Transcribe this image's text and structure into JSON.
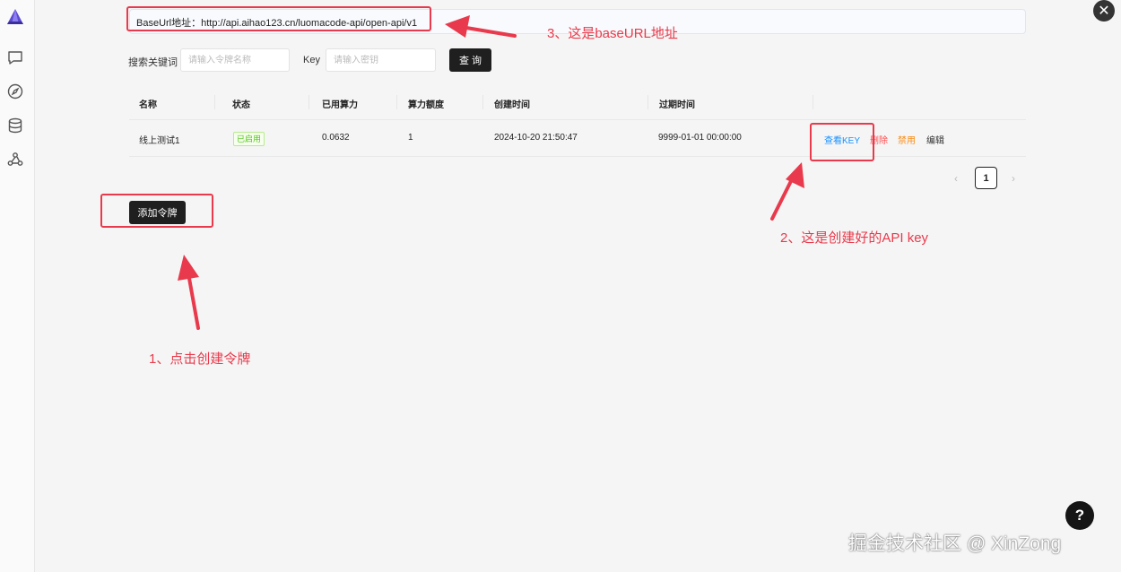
{
  "sidebar": {
    "icons": [
      "app-logo-icon",
      "chat-icon",
      "compass-icon",
      "database-icon",
      "webhook-icon"
    ]
  },
  "baseurl": {
    "text": "BaseUrl地址：http://api.aihao123.cn/luomacode-api/open-api/v1"
  },
  "search": {
    "keyword_label": "搜索关键词",
    "keyword_placeholder": "请输入令牌名称",
    "key_label": "Key",
    "key_placeholder": "请输入密钥",
    "query_button": "查 询"
  },
  "table": {
    "columns": [
      "名称",
      "状态",
      "已用算力",
      "算力额度",
      "创建时间",
      "过期时间"
    ],
    "rows": [
      {
        "name": "线上测试1",
        "status": "已启用",
        "used": "0.0632",
        "quota": "1",
        "created": "2024-10-20 21:50:47",
        "expires": "9999-01-01 00:00:00",
        "actions": {
          "view_key": "查看KEY",
          "delete": "删除",
          "disable": "禁用",
          "edit": "编辑"
        }
      }
    ]
  },
  "pagination": {
    "prev": "‹",
    "current": "1",
    "next": "›"
  },
  "add_button": "添加令牌",
  "annotations": {
    "note1": "1、点击创建令牌",
    "note2": "2、这是创建好的API key",
    "note3": "3、这是baseURL地址"
  },
  "close_symbol": "✕",
  "help_symbol": "?",
  "watermark": "掘金技术社区 @ XinZong",
  "colors": {
    "annotation_red": "#e83a4c",
    "link_blue": "#1890ff",
    "delete_red": "#ff4d4f",
    "disable_orange": "#fa8c16",
    "enabled_green": "#52c41a",
    "dark_button": "#1f1f1f"
  }
}
